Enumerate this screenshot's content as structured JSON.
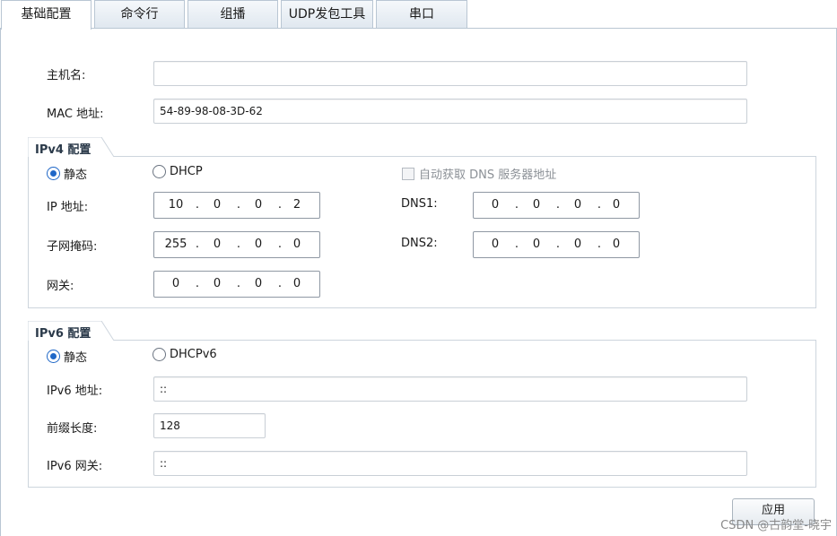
{
  "tabs": [
    {
      "label": "基础配置",
      "active": true
    },
    {
      "label": "命令行",
      "active": false
    },
    {
      "label": "组播",
      "active": false
    },
    {
      "label": "UDP发包工具",
      "active": false
    },
    {
      "label": "串口",
      "active": false
    }
  ],
  "basic": {
    "hostname_label": "主机名:",
    "hostname_value": "",
    "mac_label": "MAC 地址:",
    "mac_value": "54-89-98-08-3D-62"
  },
  "ipv4": {
    "title": "IPv4 配置",
    "static_label": "静态",
    "dhcp_label": "DHCP",
    "mode": "static",
    "auto_dns_label": "自动获取 DNS 服务器地址",
    "auto_dns_checked": false,
    "ip_label": "IP 地址:",
    "ip": [
      "10",
      "0",
      "0",
      "2"
    ],
    "mask_label": "子网掩码:",
    "mask": [
      "255",
      "0",
      "0",
      "0"
    ],
    "gateway_label": "网关:",
    "gateway": [
      "0",
      "0",
      "0",
      "0"
    ],
    "dns1_label": "DNS1:",
    "dns1": [
      "0",
      "0",
      "0",
      "0"
    ],
    "dns2_label": "DNS2:",
    "dns2": [
      "0",
      "0",
      "0",
      "0"
    ]
  },
  "ipv6": {
    "title": "IPv6 配置",
    "static_label": "静态",
    "dhcp_label": "DHCPv6",
    "mode": "static",
    "addr_label": "IPv6 地址:",
    "addr_value": "::",
    "prefix_label": "前缀长度:",
    "prefix_value": "128",
    "gateway_label": "IPv6 网关:",
    "gateway_value": "::"
  },
  "apply_label": "应用",
  "watermark": "CSDN @古韵堂-晓宇",
  "colors": {
    "accent": "#1f67c7",
    "border": "#b9c6d3"
  }
}
